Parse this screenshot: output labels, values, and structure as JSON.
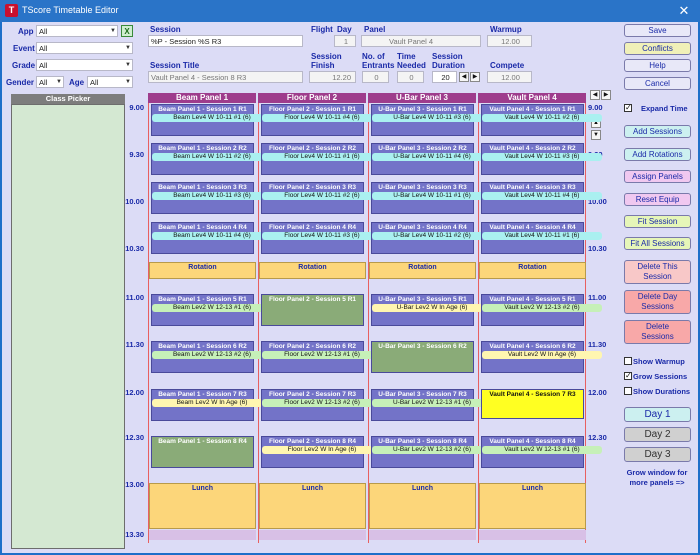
{
  "window": {
    "title": "TScore Timetable Editor",
    "app_icon": "tscore-icon",
    "close": "✕"
  },
  "filters": {
    "app": {
      "label": "App",
      "value": "All"
    },
    "event": {
      "label": "Event",
      "value": "All"
    },
    "grade": {
      "label": "Grade",
      "value": "All"
    },
    "gender": {
      "label": "Gender",
      "value": "All"
    },
    "age": {
      "label": "Age",
      "value": "All"
    },
    "clear_label": "X"
  },
  "session_fields": {
    "session_label": "Session",
    "session_value": "%P - Session %S R3",
    "flight_label": "Flight",
    "day_label": "Day",
    "day_value": "1",
    "panel_label": "Panel",
    "panel_value": "Vault Panel 4",
    "warmup_label": "Warmup",
    "warmup_value": "12.00",
    "title_label": "Session Title",
    "title_value": "Vault Panel 4 - Session 8 R3",
    "finish_label1": "Session",
    "finish_label2": "Finish",
    "finish_value": "12.20",
    "entrants_label1": "No. of",
    "entrants_label2": "Entrants",
    "entrants_value": "0",
    "needed_label1": "Time",
    "needed_label2": "Needed",
    "needed_value": "0",
    "duration_label1": "Session",
    "duration_label2": "Duration",
    "duration_value": "20",
    "compete_label": "Compete",
    "compete_value": "12.00"
  },
  "class_picker": {
    "title": "Class Picker"
  },
  "grid": {
    "columns": [
      "Beam Panel 1",
      "Floor Panel 2",
      "U-Bar Panel 3",
      "Vault Panel 4"
    ],
    "times": [
      "9.00",
      "9.30",
      "10.00",
      "10.30",
      "11.00",
      "11.30",
      "12.00",
      "12.30",
      "13.00",
      "13.30"
    ],
    "rotation_label": "Rotation",
    "lunch_label": "Lunch",
    "sessions": [
      [
        "Beam Panel 1 - Session 1 R1",
        "Beam Lev4 W 10-11 #1 (6)",
        "Floor Panel 2 - Session 1 R1",
        "Floor Lev4 W 10-11 #4 (6)",
        "U-Bar Panel 3 - Session 1 R1",
        "U-Bar Lev4 W 10-11 #3 (6)",
        "Vault Panel 4 - Session 1 R1",
        "Vault Lev4 W 10-11 #2 (6)"
      ],
      [
        "Beam Panel 1 - Session 2 R2",
        "Beam Lev4 W 10-11 #2 (6)",
        "Floor Panel 2 - Session 2 R2",
        "Floor Lev4 W 10-11 #1 (6)",
        "U-Bar Panel 3 - Session 2 R2",
        "U-Bar Lev4 W 10-11 #4 (6)",
        "Vault Panel 4 - Session 2 R2",
        "Vault Lev4 W 10-11 #3 (6)"
      ],
      [
        "Beam Panel 1 - Session 3 R3",
        "Beam Lev4 W 10-11 #3 (6)",
        "Floor Panel 2 - Session 3 R3",
        "Floor Lev4 W 10-11 #2 (6)",
        "U-Bar Panel 3 - Session 3 R3",
        "U-Bar Lev4 W 10-11 #1 (6)",
        "Vault Panel 4 - Session 3 R3",
        "Vault Lev4 W 10-11 #4 (6)"
      ],
      [
        "Beam Panel 1 - Session 4 R4",
        "Beam Lev4 W 10-11 #4 (6)",
        "Floor Panel 2 - Session 4 R4",
        "Floor Lev4 W 10-11 #3 (6)",
        "U-Bar Panel 3 - Session 4 R4",
        "U-Bar Lev4 W 10-11 #2 (6)",
        "Vault Panel 4 - Session 4 R4",
        "Vault Lev4 W 10-11 #1 (6)"
      ],
      [
        "Beam Panel 1 - Session 5 R1",
        "Beam Lev2 W 12-13 #1 (6)",
        "Floor Panel 2 - Session 5 R1",
        "",
        "U-Bar Panel 3 - Session 5 R1",
        "U-Bar Lev2 W In Age (6)",
        "Vault Panel 4 - Session 5 R1",
        "Vault Lev2 W 12-13 #2 (6)"
      ],
      [
        "Beam Panel 1 - Session 6 R2",
        "Beam Lev2 W 12-13 #2 (6)",
        "Floor Panel 2 - Session 6 R2",
        "Floor Lev2 W 12-13 #1 (6)",
        "U-Bar Panel 3 - Session 6 R2",
        "",
        "Vault Panel 4 - Session 6 R2",
        "Vault Lev2 W In Age (6)"
      ],
      [
        "Beam Panel 1 - Session 7 R3",
        "Beam Lev2 W In Age (6)",
        "Floor Panel 2 - Session 7 R3",
        "Floor Lev2 W 12-13 #2 (6)",
        "U-Bar Panel 3 - Session 7 R3",
        "U-Bar Lev2 W 12-13 #1 (6)",
        "Vault Panel 4 - Session 7 R3",
        ""
      ],
      [
        "Beam Panel 1 - Session 8 R4",
        "",
        "Floor Panel 2 - Session 8 R4",
        "Floor Lev2 W In Age (6)",
        "U-Bar Panel 3 - Session 8 R4",
        "U-Bar Lev2 W 12-13 #2 (6)",
        "Vault Panel 4 - Session 8 R4",
        "Vault Lev2 W 12-13 #1 (6)"
      ]
    ]
  },
  "buttons": {
    "save": "Save",
    "conflicts": "Conflicts",
    "help": "Help",
    "cancel": "Cancel",
    "expand_time": "Expand Time",
    "add_sessions": "Add Sessions",
    "add_rotations": "Add Rotations",
    "assign_panels": "Assign Panels",
    "reset_equip": "Reset Equip",
    "fit_session": "Fit Session",
    "fit_all_sessions": "Fit All Sessions",
    "delete_this_session_1": "Delete This",
    "delete_this_session_2": "Session",
    "delete_day_sessions_1": "Delete Day",
    "delete_day_sessions_2": "Sessions",
    "delete_sessions_1": "Delete",
    "delete_sessions_2": "Sessions",
    "show_warmup": "Show Warmup",
    "grow_sessions": "Grow Sessions",
    "show_durations": "Show Durations",
    "day1": "Day 1",
    "day2": "Day 2",
    "day3": "Day 3",
    "grow_hint_1": "Grow window for",
    "grow_hint_2": "more panels =>"
  },
  "checkbox_states": {
    "expand_time": true,
    "show_warmup": false,
    "grow_sessions": true,
    "show_durations": false
  },
  "colors": {
    "session": "#7373c8",
    "session_green": "#8aab78",
    "session_selected": "#ffff22",
    "entrant_cyan": "#aaf0f0",
    "entrant_yellow": "#fff6b0",
    "entrant_green": "#c6f0b8",
    "block": "#fcd67a",
    "header": "#9e3c8c"
  }
}
